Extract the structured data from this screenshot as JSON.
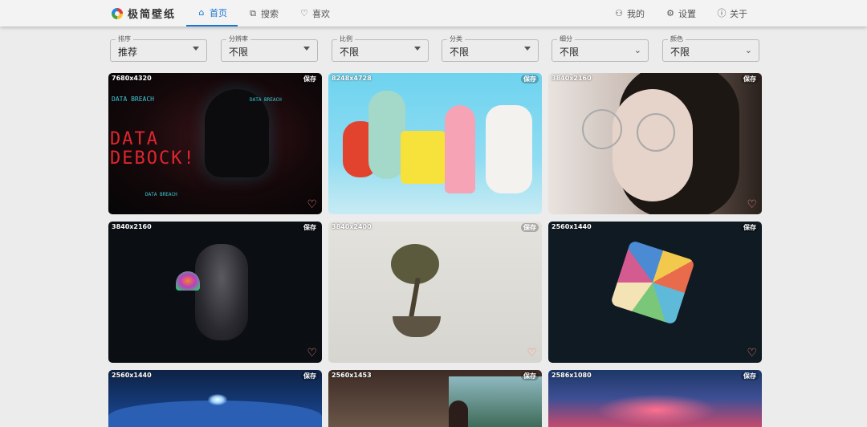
{
  "app": {
    "name": "极简壁纸"
  },
  "nav": {
    "items": [
      {
        "label": "首页",
        "icon": "home-icon",
        "active": true
      },
      {
        "label": "搜索",
        "icon": "search-icon"
      },
      {
        "label": "喜欢",
        "icon": "heart-icon"
      }
    ],
    "right": [
      {
        "label": "我的",
        "icon": "user-icon"
      },
      {
        "label": "设置",
        "icon": "gear-icon"
      },
      {
        "label": "关于",
        "icon": "info-icon"
      }
    ]
  },
  "filters": [
    {
      "label": "排序",
      "value": "推荐"
    },
    {
      "label": "分辨率",
      "value": "不限"
    },
    {
      "label": "比例",
      "value": "不限"
    },
    {
      "label": "分类",
      "value": "不限"
    },
    {
      "label": "细分",
      "value": "不限"
    },
    {
      "label": "颜色",
      "value": "不限"
    }
  ],
  "card_save_label": "保存",
  "wallpapers": [
    {
      "resolution": "7680x4320",
      "subject": "hooded-hacker",
      "overlay_texts": [
        "DATA BREACH",
        "DATA BREACH",
        "DATA BREACH",
        "DATA",
        "DEBOCK!"
      ]
    },
    {
      "resolution": "8248x4728",
      "subject": "cartoon-characters",
      "overlay_texts": []
    },
    {
      "resolution": "3840x2160",
      "subject": "girl-with-glasses",
      "overlay_texts": []
    },
    {
      "resolution": "3840x2160",
      "subject": "astronaut-jellyfish",
      "overlay_texts": []
    },
    {
      "resolution": "3840x2400",
      "subject": "floating-island-tree",
      "overlay_texts": []
    },
    {
      "resolution": "2560x1440",
      "subject": "rubiks-cube",
      "overlay_texts": []
    },
    {
      "resolution": "2560x1440",
      "subject": "planet-horizon",
      "overlay_texts": []
    },
    {
      "resolution": "2560x1453",
      "subject": "anime-interior",
      "overlay_texts": []
    },
    {
      "resolution": "2586x1080",
      "subject": "colorful-sky",
      "overlay_texts": []
    }
  ]
}
